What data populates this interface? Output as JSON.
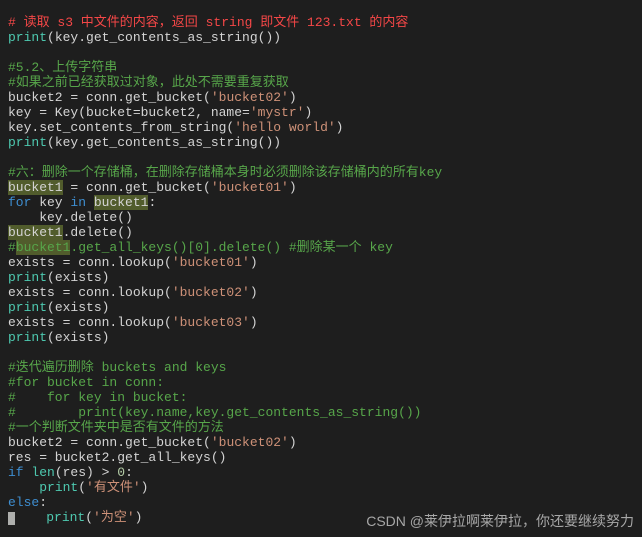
{
  "L1": "# 读取 s3 中文件的内容，返回 string 即文件 123.txt 的内容",
  "L2a": "print",
  "L2b": "(key.get_contents_as_string())",
  "L3": "",
  "L4": "#5.2、上传字符串",
  "L5": "#如果之前已经获取过对象，此处不需要重复获取",
  "L6a": "bucket2 = conn.get_bucket(",
  "L6b": "'bucket02'",
  "L6c": ")",
  "L7a": "key = Key(bucket=bucket2, name=",
  "L7b": "'mystr'",
  "L7c": ")",
  "L8a": "key.set_contents_from_string(",
  "L8b": "'hello world'",
  "L8c": ")",
  "L9a": "print",
  "L9b": "(key.get_contents_as_string())",
  "L10": "",
  "L11": "#六：删除一个存储桶，在删除存储桶本身时必须删除该存储桶内的所有key",
  "L12a": "bucket1",
  "L12b": " = conn.get_bucket(",
  "L12c": "'bucket01'",
  "L12d": ")",
  "L13a": "for",
  "L13b": " key ",
  "L13c": "in",
  "L13d": " ",
  "L13e": "bucket1",
  "L13f": ":",
  "L14": "    key.delete()",
  "L15a": "bucket1",
  "L15b": ".delete()",
  "L16a": "#",
  "L16b": "bucket1",
  "L16c": ".get_all_keys()[0].delete() #删除某一个 key",
  "L17a": "exists = conn.lookup(",
  "L17b": "'bucket01'",
  "L17c": ")",
  "L18a": "print",
  "L18b": "(exists)",
  "L19a": "exists = conn.lookup(",
  "L19b": "'bucket02'",
  "L19c": ")",
  "L20a": "print",
  "L20b": "(exists)",
  "L21a": "exists = conn.lookup(",
  "L21b": "'bucket03'",
  "L21c": ")",
  "L22a": "print",
  "L22b": "(exists)",
  "L23": "",
  "L24": "#迭代遍历删除 buckets and keys",
  "L25": "#for bucket in conn:",
  "L26": "#    for key in bucket:",
  "L27": "#        print(key.name,key.get_contents_as_string())",
  "L28": "#一个判断文件夹中是否有文件的方法",
  "L29a": "bucket2 = conn.get_bucket(",
  "L29b": "'bucket02'",
  "L29c": ")",
  "L30": "res = bucket2.get_all_keys()",
  "L31a": "if",
  "L31b": " ",
  "L31c": "len",
  "L31d": "(res) > ",
  "L31e": "0",
  "L31f": ":",
  "L32a": "    ",
  "L32b": "print",
  "L32c": "(",
  "L32d": "'有文件'",
  "L32e": ")",
  "L33a": "else",
  "L33b": ":",
  "L34a": "    ",
  "L34b": "print",
  "L34c": "(",
  "L34d": "'为空'",
  "L34e": ")",
  "watermark": "CSDN @莱伊拉啊莱伊拉，你还要继续努力"
}
